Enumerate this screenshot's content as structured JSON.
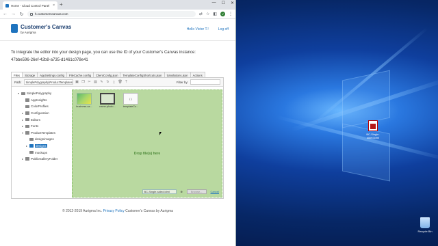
{
  "browser": {
    "tab_title": "Home - Cloud Control Panel",
    "tab_close": "×",
    "new_tab": "+",
    "url": "h.customerscanvas.com",
    "window_controls": [
      "—",
      "☐",
      "✕"
    ],
    "profile_initial": "V"
  },
  "site": {
    "brand_title": "Customer's Canvas",
    "brand_sub": "by Aurigma",
    "user_greeting": "Hello Victor T.!",
    "logout": "Log off",
    "intro_line1": "To integrate the editor into your design page, you can use the ID of your Customer's Canvas instance:",
    "instance_id": "47bbe596-26ef-42b8-a735-d1461c078e41"
  },
  "config_tabs": [
    "Files",
    "Storage",
    "AppSettings.config",
    "FileCache.config",
    "ClientConfig.json",
    "TemplateConfigShortcuts.json",
    "translations.json",
    "Actions"
  ],
  "file_manager": {
    "path_label": "Path:",
    "path_value": "SimplePolygraphy\\ProductTemplates\\designs",
    "filter_label": "Filter by:",
    "tree": [
      {
        "label": "SimplePolygraphy",
        "depth": 0,
        "arrow": "▾",
        "selected": false
      },
      {
        "label": "AppInsights",
        "depth": 1,
        "arrow": "",
        "selected": false
      },
      {
        "label": "ColorProfiles",
        "depth": 1,
        "arrow": "",
        "selected": false
      },
      {
        "label": "Configuration",
        "depth": 1,
        "arrow": "▸",
        "selected": false
      },
      {
        "label": "Editors",
        "depth": 1,
        "arrow": "▸",
        "selected": false
      },
      {
        "label": "Fonts",
        "depth": 1,
        "arrow": "▸",
        "selected": false
      },
      {
        "label": "ProductTemplates",
        "depth": 1,
        "arrow": "▾",
        "selected": false
      },
      {
        "label": "designimages",
        "depth": 2,
        "arrow": "",
        "selected": false
      },
      {
        "label": "designs",
        "depth": 2,
        "arrow": "▸",
        "selected": true
      },
      {
        "label": "mockups",
        "depth": 2,
        "arrow": "",
        "selected": false
      },
      {
        "label": "PublicGalleryFolder",
        "depth": 1,
        "arrow": "▸",
        "selected": false
      }
    ],
    "files": [
      {
        "name": "business-ca...",
        "kind": "image"
      },
      {
        "name": "name-photo...",
        "kind": "image2"
      },
      {
        "name": "templateCo...",
        "kind": "doc",
        "glyph": "{ }"
      }
    ],
    "drop_text": "Drop file(s) here",
    "selected_file": "BC-Single-sided.idml",
    "upload_button": "Browse...",
    "cancel_link": "Cancel"
  },
  "footer": {
    "copyright_prefix": "© 2012-2019 Aurigma Inc.",
    "privacy": "Privacy Policy",
    "copyright_suffix": "Customer's Canvas by Aurigma"
  },
  "desktop": {
    "file_icon_label": "BC-Single-sided.idml",
    "recycle_bin_label": "Recycle Bin"
  }
}
